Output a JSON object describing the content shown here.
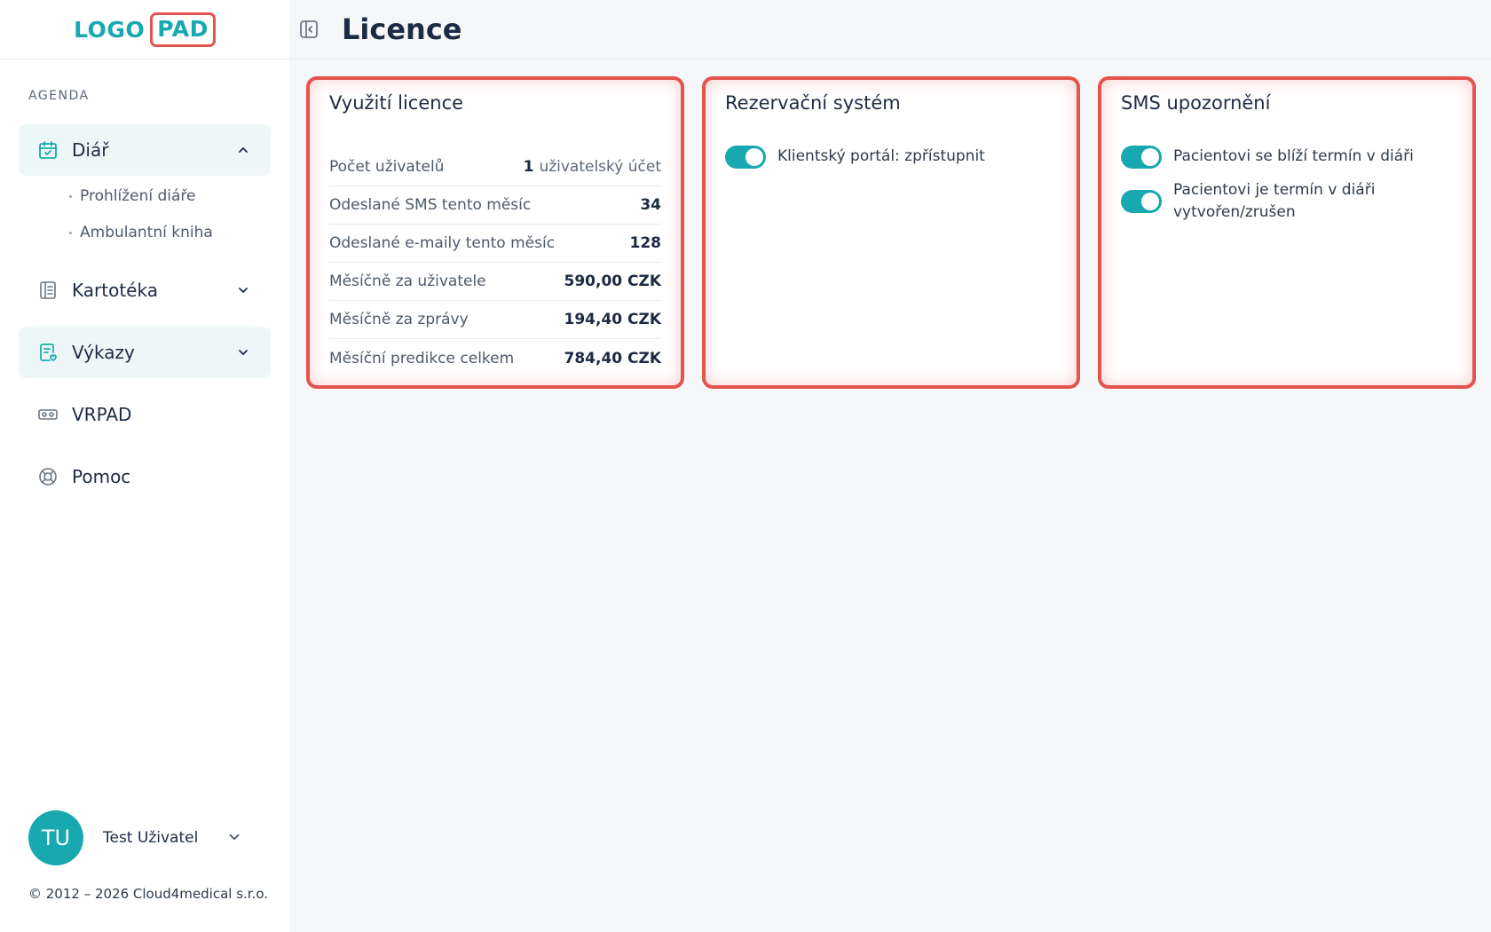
{
  "logo": {
    "part1": "LOGO",
    "part2": "PAD"
  },
  "sidebar": {
    "section_label": "AGENDA",
    "items": [
      {
        "label": "Diář",
        "icon": "calendar-check-icon",
        "expanded": true,
        "children": [
          {
            "label": "Prohlížení diáře"
          },
          {
            "label": "Ambulantní kniha"
          }
        ]
      },
      {
        "label": "Kartotéka",
        "icon": "book-icon"
      },
      {
        "label": "Výkazy",
        "icon": "report-icon"
      },
      {
        "label": "VRPAD",
        "icon": "vr-headset-icon"
      },
      {
        "label": "Pomoc",
        "icon": "lifebuoy-icon"
      }
    ],
    "user": {
      "initials": "TU",
      "name": "Test Uživatel"
    },
    "footer": "© 2012 – 2026 Cloud4medical s.r.o."
  },
  "header": {
    "title": "Licence"
  },
  "cards": {
    "license": {
      "title": "Využití licence",
      "rows": [
        {
          "label": "Počet uživatelů",
          "value_num": "1",
          "value_unit": "uživatelský účet"
        },
        {
          "label": "Odeslané SMS tento měsíc",
          "value": "34"
        },
        {
          "label": "Odeslané e-maily tento měsíc",
          "value": "128"
        },
        {
          "label": "Měsíčně za uživatele",
          "value": "590,00 CZK"
        },
        {
          "label": "Měsíčně za zprávy",
          "value": "194,40 CZK"
        },
        {
          "label": "Měsíční predikce celkem",
          "value": "784,40 CZK"
        }
      ]
    },
    "reservation": {
      "title": "Rezervační systém",
      "toggles": [
        {
          "label": "Klientský portál: zpřístupnit",
          "on": true
        }
      ]
    },
    "sms": {
      "title": "SMS upozornění",
      "toggles": [
        {
          "label": "Pacientovi se blíží termín v diáři",
          "on": true
        },
        {
          "label": "Pacientovi je termín v diáři vytvořen/zrušen",
          "on": true
        }
      ]
    }
  },
  "colors": {
    "accent": "#17a8b0",
    "highlight_border": "#e4534d",
    "text": "#1c2b44",
    "nav_active_bg": "#eef7f8"
  }
}
